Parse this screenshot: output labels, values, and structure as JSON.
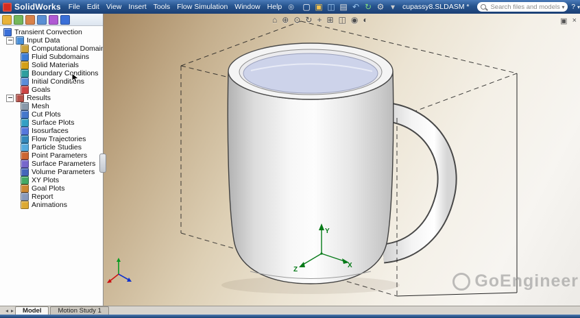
{
  "titlebar": {
    "app_name": "SolidWorks",
    "menus": [
      "File",
      "Edit",
      "View",
      "Insert",
      "Tools",
      "Flow Simulation",
      "Window",
      "Help"
    ],
    "pin_glyph": "◎",
    "doc_title": "cupassy8.SLDASM *",
    "search_placeholder": "Search files and models",
    "help_label": "?",
    "window_buttons": [
      {
        "name": "minimize-button",
        "glyph": "–"
      },
      {
        "name": "restore-button",
        "glyph": "▫"
      },
      {
        "name": "close-button",
        "glyph": "×"
      }
    ]
  },
  "toolbar_icons": [
    {
      "name": "new-document-icon",
      "glyph": "▢",
      "color": "#ffffff"
    },
    {
      "name": "open-folder-icon",
      "glyph": "▣",
      "color": "#f2c14e"
    },
    {
      "name": "save-icon",
      "glyph": "◫",
      "color": "#9ec7f0"
    },
    {
      "name": "print-icon",
      "glyph": "▤",
      "color": "#e0e0e0"
    },
    {
      "name": "undo-icon",
      "glyph": "↶",
      "color": "#9ec7f0"
    },
    {
      "name": "rebuild-icon",
      "glyph": "↻",
      "color": "#7fd87f"
    },
    {
      "name": "options-icon",
      "glyph": "⚙",
      "color": "#d8d8d8"
    },
    {
      "name": "toolbar-dropdown-icon",
      "glyph": "▾",
      "color": "#cfcfcf"
    }
  ],
  "panel_tabs": [
    {
      "name": "featuremanager-tab-icon",
      "color": "#e8b33a"
    },
    {
      "name": "propertymanager-tab-icon",
      "color": "#74b85c"
    },
    {
      "name": "configurationmanager-tab-icon",
      "color": "#d9824a"
    },
    {
      "name": "dimxpertmanager-tab-icon",
      "color": "#5a8fd4"
    },
    {
      "name": "displaymanager-tab-icon",
      "color": "#b05ad4"
    },
    {
      "name": "flow-simulation-tab-icon",
      "color": "#3a6fd8"
    }
  ],
  "tree": {
    "root": {
      "label": "Transient Convection",
      "color": "#3a6fd8"
    },
    "groups": [
      {
        "label": "Input Data",
        "color": "#4a90d9",
        "items": [
          {
            "label": "Computational Domain",
            "color": "#caa23a"
          },
          {
            "label": "Fluid Subdomains",
            "color": "#3a7bd5"
          },
          {
            "label": "Solid Materials",
            "color": "#d4a017"
          },
          {
            "label": "Boundary Conditions",
            "color": "#2e9e9e"
          },
          {
            "label": "Initial Conditions",
            "color": "#5b8dd9"
          },
          {
            "label": "Goals",
            "color": "#cc4444"
          }
        ]
      },
      {
        "label": "Results",
        "color": "#b5524a",
        "items": [
          {
            "label": "Mesh",
            "color": "#8899aa"
          },
          {
            "label": "Cut Plots",
            "color": "#4477cc"
          },
          {
            "label": "Surface Plots",
            "color": "#33a0c4"
          },
          {
            "label": "Isosurfaces",
            "color": "#5577dd"
          },
          {
            "label": "Flow Trajectories",
            "color": "#3388bb"
          },
          {
            "label": "Particle Studies",
            "color": "#55aadd"
          },
          {
            "label": "Point Parameters",
            "color": "#cc6633"
          },
          {
            "label": "Surface Parameters",
            "color": "#7766cc"
          },
          {
            "label": "Volume Parameters",
            "color": "#4466bb"
          },
          {
            "label": "XY Plots",
            "color": "#44aa66"
          },
          {
            "label": "Goal Plots",
            "color": "#cc8833"
          },
          {
            "label": "Report",
            "color": "#8899bb"
          },
          {
            "label": "Animations",
            "color": "#ddaa33"
          }
        ]
      }
    ]
  },
  "view_toolbar": [
    {
      "name": "zoom-fit-icon",
      "glyph": "⌂"
    },
    {
      "name": "zoom-area-icon",
      "glyph": "⊕"
    },
    {
      "name": "zoom-in-out-icon",
      "glyph": "⊙"
    },
    {
      "name": "rotate-view-icon",
      "glyph": "↻"
    },
    {
      "name": "pan-icon",
      "glyph": "+"
    },
    {
      "name": "view-orientation-icon",
      "glyph": "⊞"
    },
    {
      "name": "display-style-icon",
      "glyph": "◫"
    },
    {
      "name": "hide-show-icon",
      "glyph": "◉"
    },
    {
      "name": "appearance-icon",
      "glyph": "◐"
    }
  ],
  "viewport": {
    "watermark": "GoEngineer",
    "triad": {
      "x": "X",
      "y": "Y",
      "z": "Z"
    },
    "corner_icons": [
      {
        "name": "restore-view-window-icon",
        "glyph": "▣"
      },
      {
        "name": "close-view-window-icon",
        "glyph": "×"
      }
    ]
  },
  "tabbar": {
    "scroll_icons": [
      {
        "name": "tab-scroll-left-icon",
        "glyph": "◂"
      },
      {
        "name": "tab-scroll-right-icon",
        "glyph": "▸"
      }
    ],
    "tabs": [
      {
        "label": "Model",
        "active": true
      },
      {
        "label": "Motion Study 1",
        "active": false
      }
    ]
  },
  "colors": {
    "titlebar_blue": "#26548e",
    "viewport_tan": "#a5865f",
    "liquid_lavender": "#cdd3ea",
    "watermark_gray": "#8d8d8d",
    "triad_green": "#067a18"
  }
}
